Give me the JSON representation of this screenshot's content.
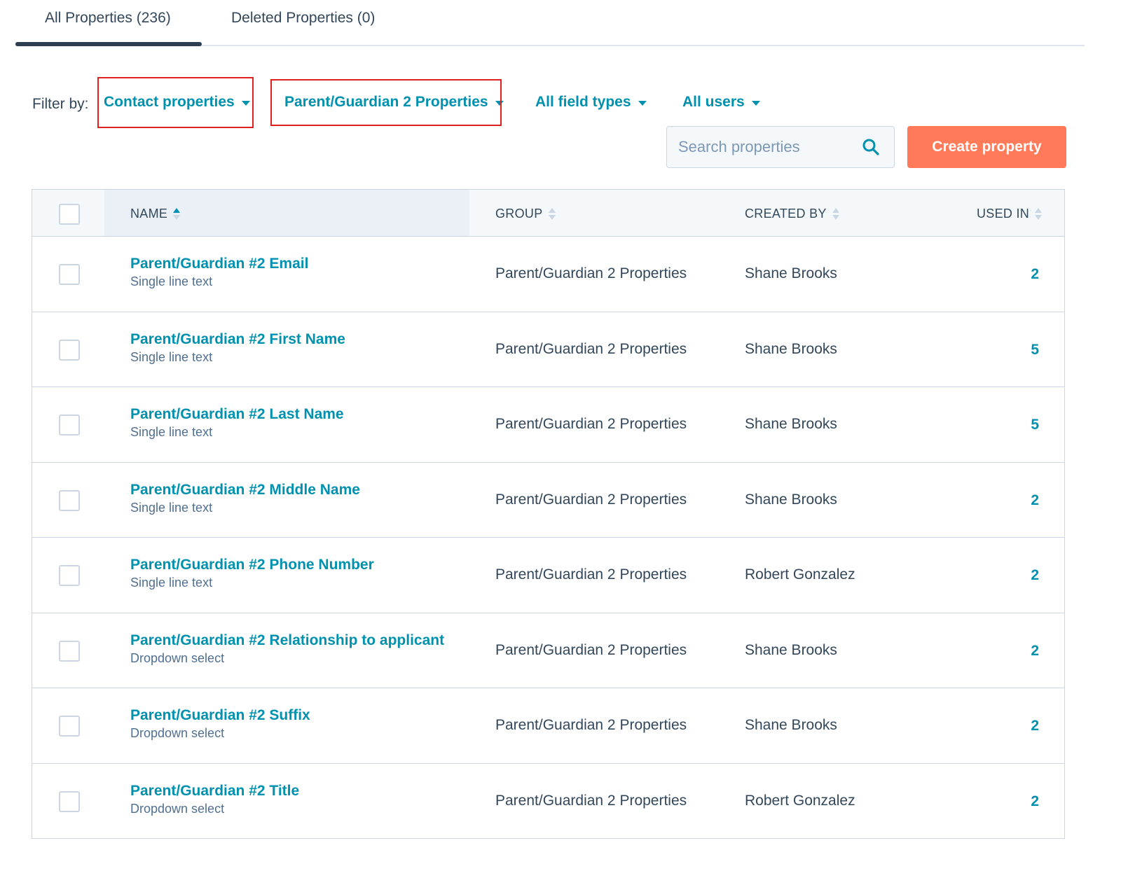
{
  "tabs": {
    "all_label": "All Properties (236)",
    "deleted_label": "Deleted Properties (0)"
  },
  "filters": {
    "label": "Filter by:",
    "object": "Contact properties",
    "group": "Parent/Guardian 2 Properties",
    "field_type": "All field types",
    "users": "All users"
  },
  "search": {
    "placeholder": "Search properties"
  },
  "create_button": "Create property",
  "table": {
    "headers": {
      "name": "NAME",
      "group": "GROUP",
      "created_by": "CREATED BY",
      "used_in": "USED IN"
    },
    "rows": [
      {
        "name": "Parent/Guardian #2 Email",
        "type": "Single line text",
        "group": "Parent/Guardian 2 Properties",
        "created_by": "Shane Brooks",
        "used_in": "2"
      },
      {
        "name": "Parent/Guardian #2 First Name",
        "type": "Single line text",
        "group": "Parent/Guardian 2 Properties",
        "created_by": "Shane Brooks",
        "used_in": "5"
      },
      {
        "name": "Parent/Guardian #2 Last Name",
        "type": "Single line text",
        "group": "Parent/Guardian 2 Properties",
        "created_by": "Shane Brooks",
        "used_in": "5"
      },
      {
        "name": "Parent/Guardian #2 Middle Name",
        "type": "Single line text",
        "group": "Parent/Guardian 2 Properties",
        "created_by": "Shane Brooks",
        "used_in": "2"
      },
      {
        "name": "Parent/Guardian #2 Phone Number",
        "type": "Single line text",
        "group": "Parent/Guardian 2 Properties",
        "created_by": "Robert Gonzalez",
        "used_in": "2"
      },
      {
        "name": "Parent/Guardian #2 Relationship to applicant",
        "type": "Dropdown select",
        "group": "Parent/Guardian 2 Properties",
        "created_by": "Shane Brooks",
        "used_in": "2"
      },
      {
        "name": "Parent/Guardian #2 Suffix",
        "type": "Dropdown select",
        "group": "Parent/Guardian 2 Properties",
        "created_by": "Shane Brooks",
        "used_in": "2"
      },
      {
        "name": "Parent/Guardian #2 Title",
        "type": "Dropdown select",
        "group": "Parent/Guardian 2 Properties",
        "created_by": "Robert Gonzalez",
        "used_in": "2"
      }
    ]
  },
  "colors": {
    "link": "#0091ae",
    "text": "#33475b",
    "accent_button": "#ff7a59",
    "highlight_box": "#e0201f",
    "tab_underline": "#2d3e50"
  }
}
